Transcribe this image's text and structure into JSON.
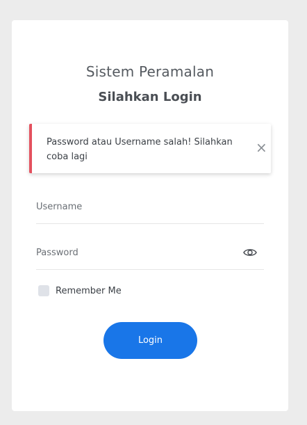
{
  "app": {
    "title": "Sistem Peramalan",
    "subtitle": "Silahkan Login"
  },
  "alert": {
    "message": "Password atau Username salah! Silahkan coba lagi",
    "close_icon": "close-icon",
    "accent_color": "#e4515e"
  },
  "form": {
    "username": {
      "placeholder": "Username",
      "value": ""
    },
    "password": {
      "placeholder": "Password",
      "value": "",
      "toggle_icon": "eye-icon"
    },
    "remember": {
      "label": "Remember Me",
      "checked": false
    },
    "submit_label": "Login"
  },
  "colors": {
    "background": "#ececec",
    "card": "#ffffff",
    "button": "#1976e8",
    "alert_border": "#e4515e"
  }
}
